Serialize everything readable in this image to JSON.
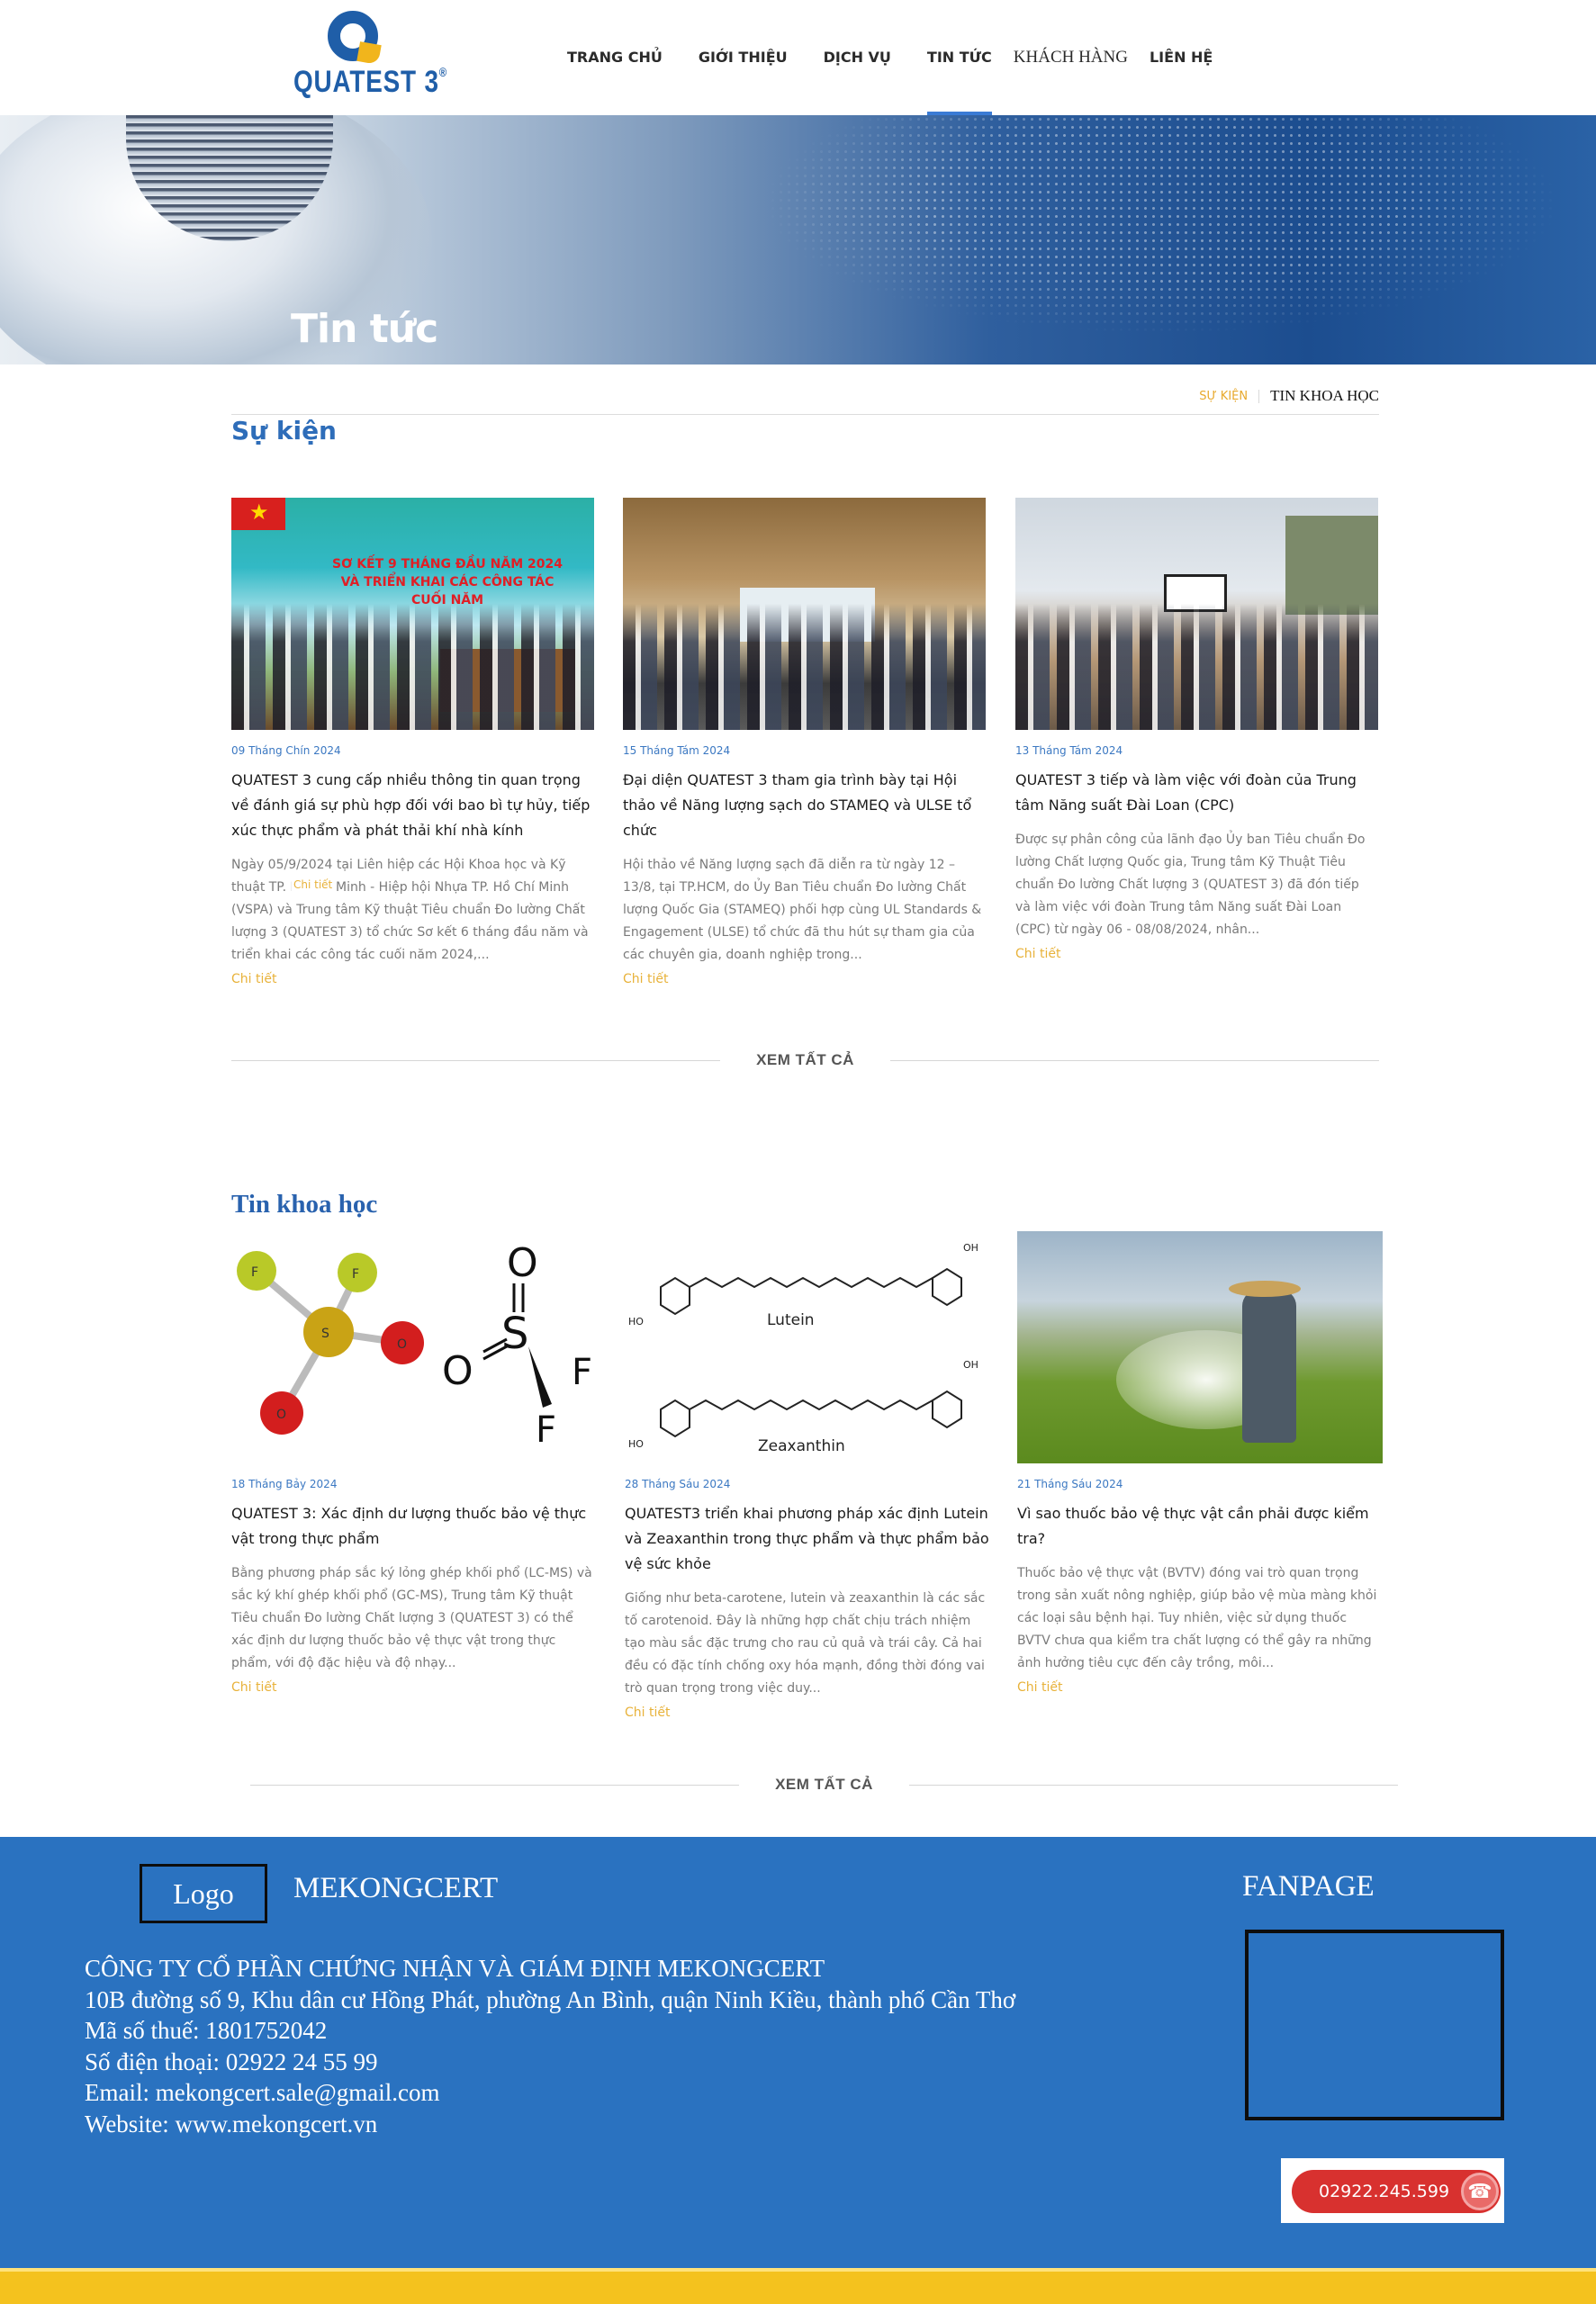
{
  "header": {
    "logo_text": "QUATEST 3",
    "logo_reg": "®",
    "nav": [
      {
        "label": "TRANG CHỦ"
      },
      {
        "label": "GIỚI THIỆU"
      },
      {
        "label": "DỊCH VỤ"
      },
      {
        "label": "TIN TỨC",
        "active": true
      },
      {
        "label": "KHÁCH HÀNG"
      },
      {
        "label": "LIÊN HỆ"
      }
    ]
  },
  "banner": {
    "title": "Tin tức"
  },
  "category_tabs": [
    {
      "label": "SỰ KIỆN",
      "active": true
    },
    {
      "label": "TIN KHOA HỌC"
    }
  ],
  "events": {
    "title": "Sự kiện",
    "view_all": "XEM TẤT CẢ",
    "image_overlay_text": "SƠ KẾT 9 THÁNG ĐẦU NĂM 2024 VÀ TRIỂN KHAI CÁC CÔNG TÁC CUỐI NĂM",
    "image_overlay_caption": "Chi tiết",
    "cards": [
      {
        "date": "09 Tháng Chín 2024",
        "title": "QUATEST 3 cung cấp nhiều thông tin quan trọng về đánh giá sự phù hợp đối với bao bì tự hủy, tiếp xúc thực phẩm và phát thải khí nhà kính",
        "excerpt": "Ngày 05/9/2024 tại Liên hiệp các Hội Khoa học và Kỹ thuật TP. Hồ Chí Minh - Hiệp hội Nhựa TP. Hồ Chí Minh (VSPA) và Trung tâm Kỹ thuật Tiêu chuẩn Đo lường Chất lượng 3 (QUATEST 3) tổ chức Sơ kết 6 tháng đầu năm và triển khai các công tác cuối năm 2024,...",
        "more": "Chi tiết"
      },
      {
        "date": "15 Tháng Tám 2024",
        "title": "Đại diện QUATEST 3 tham gia trình bày tại Hội thảo về Năng lượng sạch do STAMEQ và ULSE tổ chức",
        "excerpt": "Hội thảo về Năng lượng sạch đã diễn ra từ ngày 12 – 13/8, tại TP.HCM, do Ủy Ban Tiêu chuẩn Đo lường Chất lượng Quốc Gia (STAMEQ) phối hợp cùng UL Standards & Engagement (ULSE) tổ chức đã thu hút sự tham gia của các chuyên gia, doanh nghiệp trong...",
        "more": "Chi tiết"
      },
      {
        "date": "13 Tháng Tám 2024",
        "title": "QUATEST 3 tiếp và làm việc với đoàn của Trung tâm Năng suất Đài Loan (CPC)",
        "excerpt": "Được sự phân công của lãnh đạo Ủy ban Tiêu chuẩn Đo lường Chất lượng Quốc gia, Trung tâm Kỹ Thuật Tiêu chuẩn Đo lường Chất lượng 3 (QUATEST 3) đã đón tiếp và làm việc với đoàn Trung tâm Năng suất Đài Loan (CPC) từ ngày 06 - 08/08/2024, nhân...",
        "more": "Chi tiết"
      }
    ]
  },
  "science": {
    "title": "Tin khoa học",
    "view_all": "XEM TẤT CẢ",
    "molecule_labels": {
      "lutein": "Lutein",
      "zeaxanthin": "Zeaxanthin",
      "oh": "OH",
      "ho": "HO",
      "s": "S",
      "o": "O",
      "f": "F"
    },
    "cards": [
      {
        "date": "18 Tháng Bảy 2024",
        "title": "QUATEST 3: Xác định dư lượng thuốc bảo vệ thực vật trong thực phẩm",
        "excerpt": "Bằng phương pháp sắc ký lỏng ghép khối phổ (LC-MS) và sắc ký khí ghép khối phổ (GC-MS), Trung tâm Kỹ thuật Tiêu chuẩn Đo lường Chất lượng 3 (QUATEST 3) có thể xác định dư lượng thuốc bảo vệ thực vật trong thực phẩm, với độ đặc hiệu và độ nhạy...",
        "more": "Chi tiết"
      },
      {
        "date": "28 Tháng Sáu 2024",
        "title": "QUATEST3 triển khai phương pháp xác định Lutein và Zeaxanthin trong thực phẩm và thực phẩm bảo vệ sức khỏe",
        "excerpt": "Giống như beta-carotene, lutein và zeaxanthin là các sắc tố carotenoid. Đây là những hợp chất chịu trách nhiệm tạo màu sắc đặc trưng cho rau củ quả và trái cây. Cả hai đều có đặc tính chống oxy hóa mạnh, đồng thời đóng vai trò quan trọng trong việc duy...",
        "more": "Chi tiết"
      },
      {
        "date": "21 Tháng Sáu 2024",
        "title": "Vì sao thuốc bảo vệ thực vật cần phải được kiểm tra?",
        "excerpt": "Thuốc bảo vệ thực vật (BVTV) đóng vai trò quan trọng trong sản xuất nông nghiệp, giúp bảo vệ mùa màng khỏi các loại sâu bệnh hại. Tuy nhiên, việc sử dụng thuốc BVTV chưa qua kiểm tra chất lượng có thể gây ra những ảnh hưởng tiêu cực đến cây trồng, môi...",
        "more": "Chi tiết"
      }
    ]
  },
  "footer": {
    "logo_placeholder": "Logo",
    "brand": "MEKONGCERT",
    "fanpage_title": "FANPAGE",
    "company": "CÔNG TY CỔ PHẦN CHỨNG NHẬN VÀ GIÁM ĐỊNH MEKONGCERT",
    "address": "10B đường số 9, Khu dân cư Hồng Phát, phường An Bình, quận Ninh Kiều, thành phố Cần Thơ",
    "tax": "Mã số thuế: 1801752042",
    "phone": "Số điện thoại: 02922 24 55 99",
    "email": "Email: mekongcert.sale@gmail.com",
    "website": "Website: www.mekongcert.vn",
    "call_button": "02922.245.599",
    "call_icon": "phone-icon"
  },
  "colors": {
    "brand_blue": "#1f5ea8",
    "section_blue": "#2e6db9",
    "footer_blue": "#2a72c0",
    "accent_yellow": "#e8b23a",
    "footer_strip": "#f4c21e",
    "call_red": "#d8312f"
  }
}
